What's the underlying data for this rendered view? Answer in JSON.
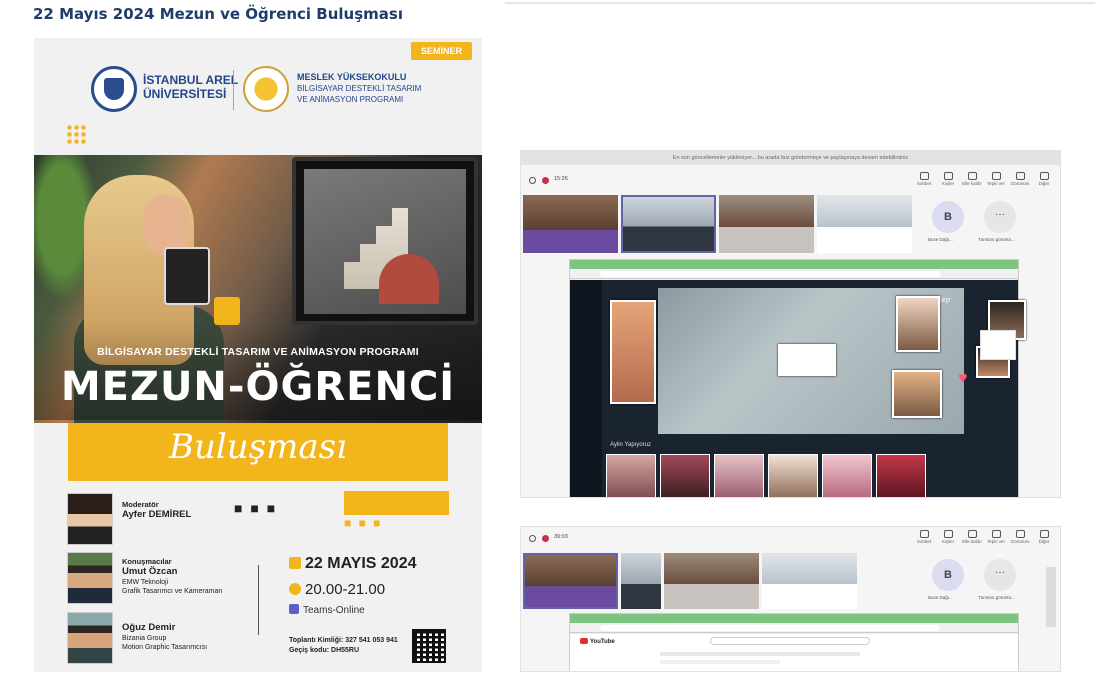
{
  "page_title": "22 Mayıs 2024 Mezun ve Öğrenci Buluşması",
  "poster": {
    "badge": "SEMİNER",
    "arel": {
      "line1": "İSTANBUL AREL",
      "line2": "ÜNİVERSİTESİ"
    },
    "myo": {
      "line1": "MESLEK YÜKSEKOKULU",
      "line2": "BİLGİSAYAR DESTEKLİ TASARIM",
      "line3": "VE ANİMASYON PROGRAMI"
    },
    "program_title": "BİLGİSAYAR DESTEKLİ TASARIM VE ANİMASYON PROGRAMI",
    "main_title": "MEZUN-ÖĞRENCİ",
    "script_title": "Buluşması",
    "moderator": {
      "role": "Moderatör",
      "name": "Ayfer DEMİREL"
    },
    "speakers_label": "Konuşmacılar",
    "speaker1": {
      "name": "Umut Özcan",
      "line1": "EMW Teknoloji",
      "line2": "Grafik Tasarımcı ve Kameraman"
    },
    "speaker2": {
      "name": "Oğuz Demir",
      "line1": "Bizania Group",
      "line2": "Motion Graphic Tasarımcısı"
    },
    "date": "22 MAYIS 2024",
    "time": "20.00-21.00",
    "platform": "Teams-Online",
    "meeting_id": "Toplantı Kimliği: 327 541 053 941",
    "passcode": "Geçiş kodu: DH55RU"
  },
  "screenshot1": {
    "notice": "En son güncellemeler yükleniyor... bu arada faiz göndermeye ve paylaşmaya devam edebilirsiniz",
    "timer": "15:26",
    "participant_initial": "B",
    "participant_name": "Buse Dağı...",
    "more_label": "Tümünü görüntü...",
    "toolbar": [
      "Sohbet",
      "Kişiler",
      "Elle kaldır",
      "Tepki ver",
      "Görünüm",
      "Diğer"
    ],
    "content_title": "Elep",
    "row_label": "Aylin Yapıyoruz"
  },
  "screenshot2": {
    "timer": "39:03",
    "participant_initial": "B",
    "participant_name": "Buse Dağı...",
    "more_label": "Tümünü görüntü...",
    "toolbar": [
      "Sohbet",
      "Kişiler",
      "Elle kaldır",
      "Tepki ver",
      "Görünüm",
      "Diğer"
    ],
    "yt_label": "YouTube"
  }
}
